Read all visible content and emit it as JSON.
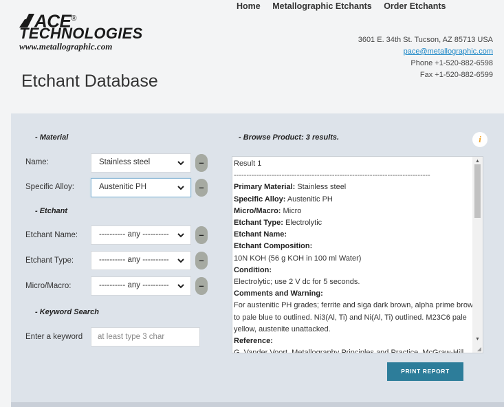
{
  "brand": {
    "logo_text_ace": "ACE",
    "logo_text_tech": "TECHNOLOGIES",
    "logo_reg": "®",
    "website": "www.metallographic.com"
  },
  "nav": {
    "items": [
      "Home",
      "Metallographic Etchants",
      "Order Etchants"
    ]
  },
  "contact": {
    "address": "3601 E. 34th St. Tucson, AZ 85713 USA",
    "email": "pace@metallographic.com",
    "phone": "Phone +1-520-882-6598",
    "fax": "Fax +1-520-882-6599"
  },
  "page_title": "Etchant Database",
  "material_section": {
    "title": "- Material",
    "name_label": "Name:",
    "name_value": "Stainless steel",
    "alloy_label": "Specific Alloy:",
    "alloy_value": "Austenitic PH"
  },
  "etchant_section": {
    "title": "- Etchant",
    "etchant_name_label": "Etchant Name:",
    "etchant_name_value": "---------- any ----------",
    "etchant_type_label": "Etchant Type:",
    "etchant_type_value": "---------- any ----------",
    "micro_macro_label": "Micro/Macro:",
    "micro_macro_value": "---------- any ----------"
  },
  "keyword_section": {
    "title": "- Keyword Search",
    "label": "Enter a keyword",
    "placeholder": "at least type 3 char"
  },
  "browse": {
    "title": "- Browse Product: 3 results.",
    "info_icon": "i",
    "result_heading": "Result 1",
    "divider": "------------------------------------------------------------------------------",
    "fields": {
      "primary_material_label": "Primary Material:",
      "primary_material_value": "Stainless steel",
      "specific_alloy_label": "Specific Alloy:",
      "specific_alloy_value": "Austenitic PH",
      "micro_macro_label": "Micro/Macro:",
      "micro_macro_value": "Micro",
      "etchant_type_label": "Etchant Type:",
      "etchant_type_value": "Electrolytic",
      "etchant_name_label": "Etchant Name:",
      "composition_label": "Etchant Composition:",
      "composition_value": "10N KOH (56 g KOH in 100 ml Water)",
      "condition_label": "Condition:",
      "condition_value": "Electrolytic; use 2 V dc for 5 seconds.",
      "comments_label": "Comments and Warning:",
      "comments_line1": "For austenitic PH grades; ferrite and siga dark brown, alpha prime brown",
      "comments_line2": "to pale blue to outlined. Ni3(Al, Ti) and Ni(Al, Ti) outlined. M23C6 pale",
      "comments_line3": "yellow, austenite unattacked.",
      "reference_label": "Reference:",
      "reference_value": "G. Vander Voort, Metallography Principles and Practice, McGraw-Hill"
    }
  },
  "print_button": "PRINT REPORT",
  "minus_symbol": "–",
  "colors": {
    "panel_bg": "#dde3ea",
    "button_bg": "#2d7d9a",
    "link": "#1e88c7",
    "info_icon": "#f0a020"
  }
}
